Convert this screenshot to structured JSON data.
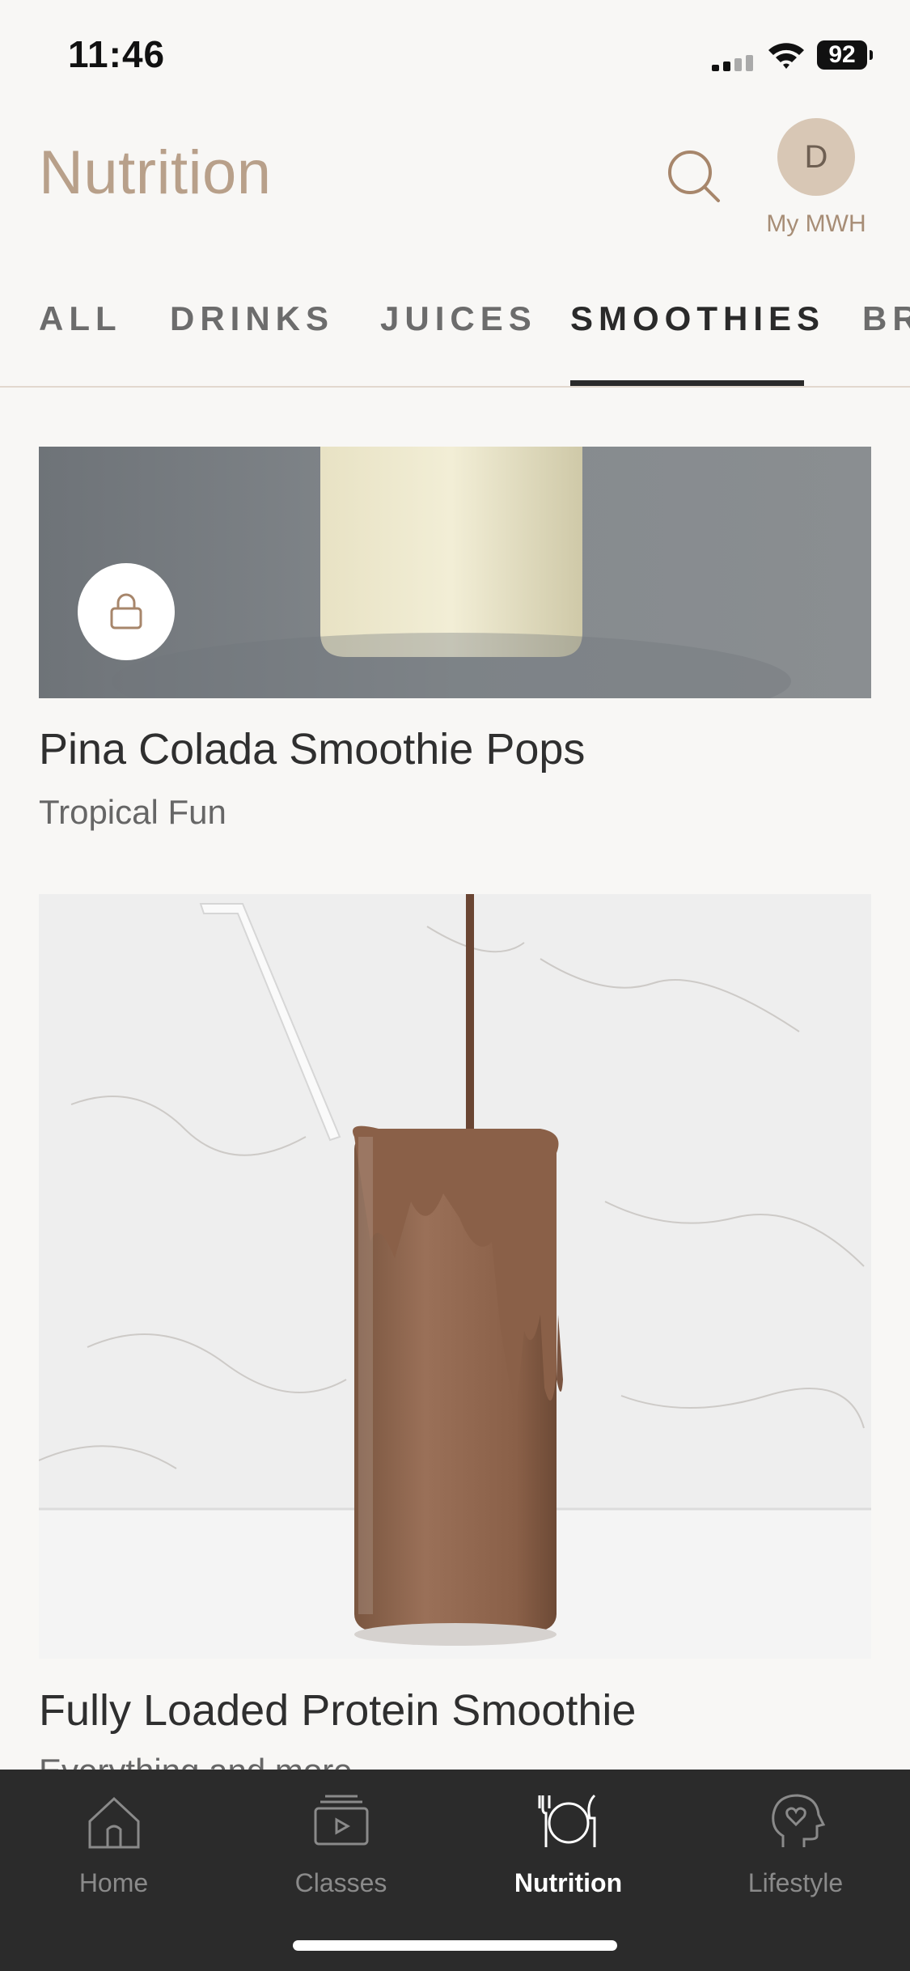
{
  "status": {
    "time": "11:46",
    "battery": "92"
  },
  "header": {
    "title": "Nutrition",
    "avatar_initial": "D",
    "avatar_label": "My MWH"
  },
  "tabs": [
    {
      "label": "ALL"
    },
    {
      "label": "DRINKS"
    },
    {
      "label": "JUICES"
    },
    {
      "label": "SMOOTHIES",
      "active": true
    },
    {
      "label": "BR"
    }
  ],
  "cards": [
    {
      "title": "Pina Colada Smoothie Pops",
      "subtitle": "Tropical Fun",
      "locked": true
    },
    {
      "title": "Fully Loaded Protein Smoothie",
      "subtitle": "Everything and more"
    }
  ],
  "nav": [
    {
      "label": "Home",
      "icon": "home-icon"
    },
    {
      "label": "Classes",
      "icon": "classes-icon"
    },
    {
      "label": "Nutrition",
      "icon": "nutrition-icon",
      "active": true
    },
    {
      "label": "Lifestyle",
      "icon": "lifestyle-icon"
    }
  ],
  "colors": {
    "background": "#f8f7f5",
    "accent": "#b8a08a",
    "nav_background": "#2b2b2b",
    "avatar": "#d8c7b5"
  }
}
